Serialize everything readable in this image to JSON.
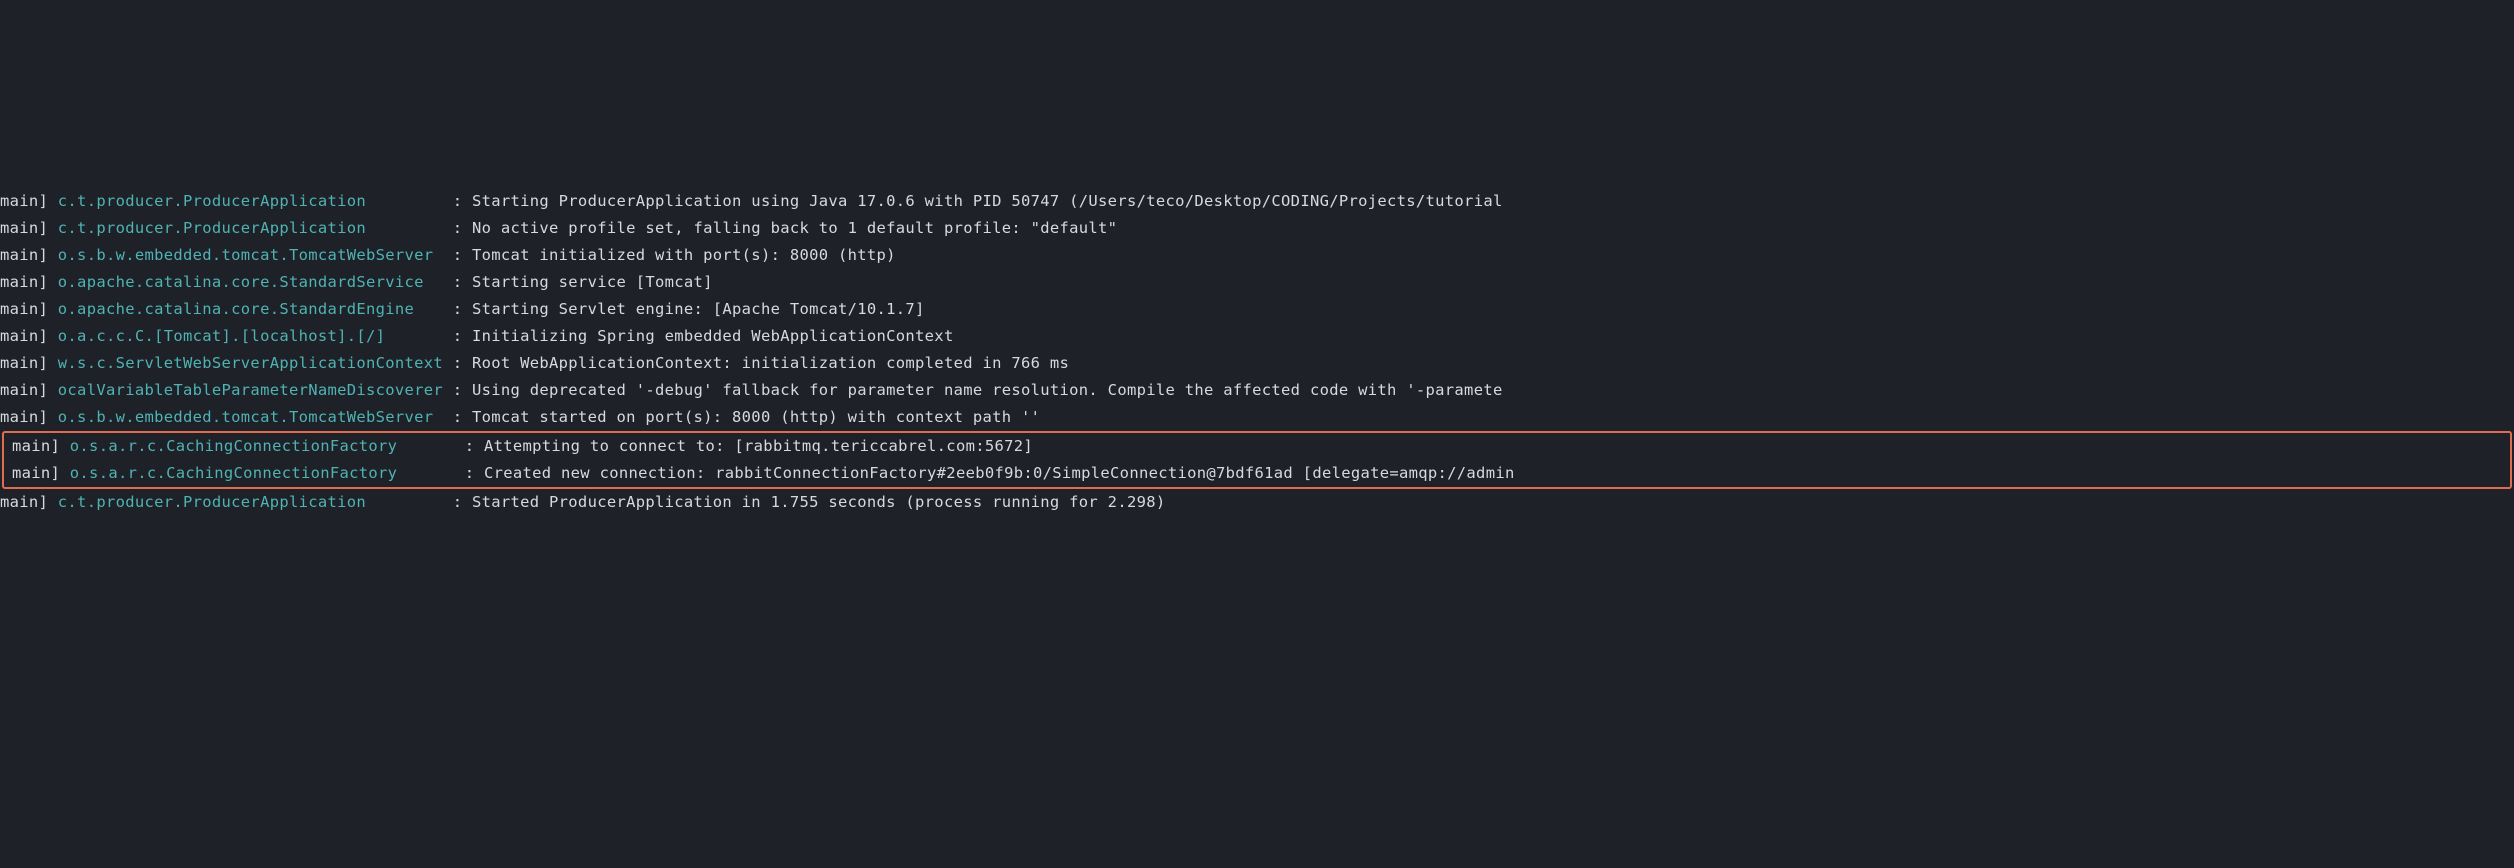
{
  "logs": [
    {
      "thread": "main] ",
      "logger": "c.t.producer.ProducerApplication        ",
      "sep": " : ",
      "msg": "Starting ProducerApplication using Java 17.0.6 with PID 50747 (/Users/teco/Desktop/CODING/Projects/tutorial"
    },
    {
      "thread": "main] ",
      "logger": "c.t.producer.ProducerApplication        ",
      "sep": " : ",
      "msg": "No active profile set, falling back to 1 default profile: \"default\""
    },
    {
      "thread": "main] ",
      "logger": "o.s.b.w.embedded.tomcat.TomcatWebServer ",
      "sep": " : ",
      "msg": "Tomcat initialized with port(s): 8000 (http)"
    },
    {
      "thread": "main] ",
      "logger": "o.apache.catalina.core.StandardService  ",
      "sep": " : ",
      "msg": "Starting service [Tomcat]"
    },
    {
      "thread": "main] ",
      "logger": "o.apache.catalina.core.StandardEngine   ",
      "sep": " : ",
      "msg": "Starting Servlet engine: [Apache Tomcat/10.1.7]"
    },
    {
      "thread": "main] ",
      "logger": "o.a.c.c.C.[Tomcat].[localhost].[/]      ",
      "sep": " : ",
      "msg": "Initializing Spring embedded WebApplicationContext"
    },
    {
      "thread": "main] ",
      "logger": "w.s.c.ServletWebServerApplicationContext",
      "sep": " : ",
      "msg": "Root WebApplicationContext: initialization completed in 766 ms"
    },
    {
      "thread": "main] ",
      "logger": "ocalVariableTableParameterNameDiscoverer",
      "sep": " : ",
      "msg": "Using deprecated '-debug' fallback for parameter name resolution. Compile the affected code with '-paramete"
    },
    {
      "thread": "main] ",
      "logger": "o.s.b.w.embedded.tomcat.TomcatWebServer ",
      "sep": " : ",
      "msg": "Tomcat started on port(s): 8000 (http) with context path ''"
    },
    {
      "thread": "main] ",
      "logger": "o.s.a.r.c.CachingConnectionFactory      ",
      "sep": " : ",
      "msg": "Attempting to connect to: [rabbitmq.tericcabrel.com:5672]"
    },
    {
      "thread": "main] ",
      "logger": "o.s.a.r.c.CachingConnectionFactory      ",
      "sep": " : ",
      "msg": "Created new connection: rabbitConnectionFactory#2eeb0f9b:0/SimpleConnection@7bdf61ad [delegate=amqp://admin"
    },
    {
      "thread": "main] ",
      "logger": "c.t.producer.ProducerApplication        ",
      "sep": " : ",
      "msg": "Started ProducerApplication in 1.755 seconds (process running for 2.298)"
    }
  ],
  "highlighted_indices": [
    9,
    10
  ]
}
